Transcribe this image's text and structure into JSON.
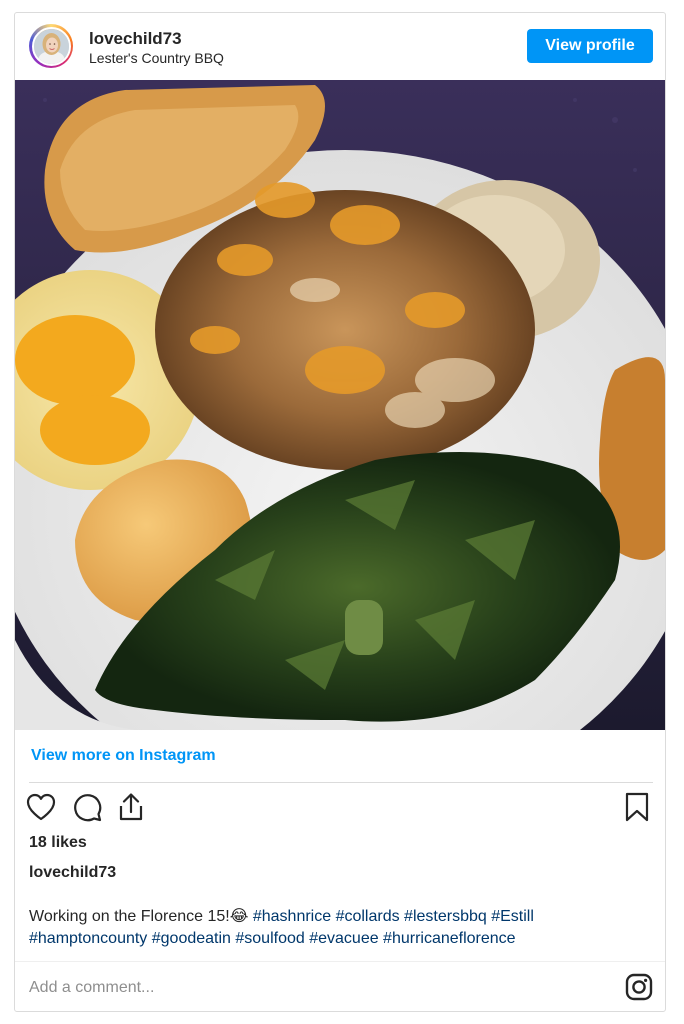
{
  "header": {
    "username": "lovechild73",
    "location": "Lester's Country BBQ",
    "view_profile_label": "View profile"
  },
  "photo": {
    "alt": "Plate of BBQ with hash and rice, collard greens, macaroni and cheese, sweet potato and fried chicken"
  },
  "view_more_label": "View more on Instagram",
  "actions": {
    "like_icon": "heart-icon",
    "comment_icon": "comment-icon",
    "share_icon": "share-icon",
    "save_icon": "bookmark-icon"
  },
  "likes": "18 likes",
  "caption": {
    "username": "lovechild73",
    "text": "Working on the Florence 15!😂 ",
    "hashtags": "#hashnrice #collards #lestersbbq #Estill #hamptoncounty #goodeatin #soulfood #evacuee #hurricaneflorence"
  },
  "comment_placeholder": "Add a comment...",
  "colors": {
    "accent": "#0095f6",
    "hashtag": "#00376b",
    "border": "#dbdbdb"
  }
}
